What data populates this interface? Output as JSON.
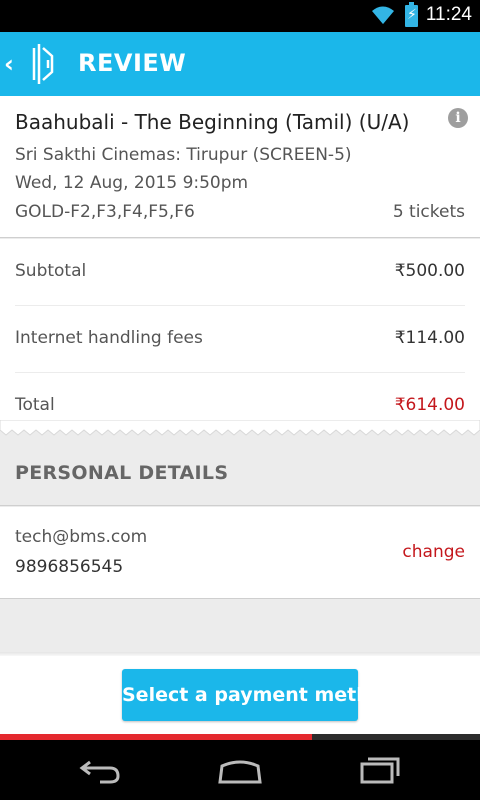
{
  "status_bar": {
    "time": "11:24",
    "icons": [
      "wifi-icon",
      "battery-charging-icon"
    ],
    "accent_color": "#33b5e5"
  },
  "app_bar": {
    "title": "REVIEW",
    "background_color": "#1bb7ea",
    "icons": [
      "back-chevron-icon",
      "app-logo"
    ]
  },
  "booking": {
    "movie_title": "Baahubali - The Beginning (Tamil) (U/A)",
    "cinema": "Sri Sakthi Cinemas: Tirupur (SCREEN-5)",
    "showtime": "Wed, 12 Aug, 2015 9:50pm",
    "seats": "GOLD-F2,F3,F4,F5,F6",
    "ticket_count": "5 tickets",
    "info_icon": "info-icon"
  },
  "pricing": {
    "rows": [
      {
        "label": "Subtotal",
        "value": "₹500.00"
      },
      {
        "label": "Internet handling fees",
        "value": "₹114.00"
      },
      {
        "label": "Total",
        "value": "₹614.00"
      }
    ],
    "total_color": "#c4171c"
  },
  "personal": {
    "header": "PERSONAL DETAILS",
    "email": "tech@bms.com",
    "phone": "9896856545",
    "change_label": "change"
  },
  "footer": {
    "pay_button_label": "Select a payment method",
    "progress_fraction": 0.65
  },
  "nav_bar": {
    "icons": [
      "back-nav-icon",
      "home-nav-icon",
      "recents-nav-icon"
    ]
  }
}
